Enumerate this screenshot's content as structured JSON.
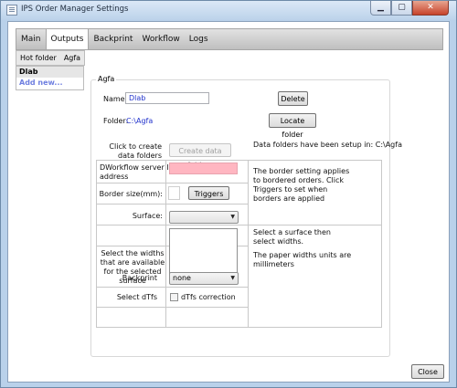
{
  "window": {
    "title": "IPS Order Manager Settings"
  },
  "caption_buttons": {
    "minimize_icon": "minimize-icon",
    "maximize_icon": "maximize-icon",
    "close_icon": "close-icon",
    "min_glyph": "▁",
    "max_glyph": "▢",
    "close_glyph": "✕"
  },
  "main_tabs": [
    "Main",
    "Outputs",
    "Backprint",
    "Workflow",
    "Logs"
  ],
  "sub_tabs": [
    "Hot folder",
    "Agfa"
  ],
  "list": {
    "items": [
      "Dlab"
    ],
    "add_label": "Add new..."
  },
  "group": {
    "title": "Agfa"
  },
  "form": {
    "name_label": "Name:",
    "name_value": "Dlab",
    "delete_label": "Delete",
    "folder_label": "Folder:",
    "folder_value": "C:\\Agfa",
    "locate_label": "Locate folder",
    "create_label_1": "Click to create",
    "create_label_2": "data folders",
    "create_button": "Create data folders",
    "create_status": "Data folders have been setup in: C:\\Agfa",
    "ip_label_1": "DWorkflow server IP",
    "ip_label_2": "address",
    "ip_value": "",
    "border_label": "Border size(mm):",
    "triggers_label": "Triggers",
    "border_help": [
      "The border setting applies",
      "to bordered orders. Click",
      "Triggers to set when",
      "borders are applied"
    ],
    "surface_label": "Surface:",
    "surface_value": "",
    "surface_help": [
      "Select a surface then",
      "select widths."
    ],
    "widths_label": [
      "Select the widths",
      "that are available",
      "for the selected",
      "surface"
    ],
    "widths_help": [
      "The paper widths units are",
      "millimeters"
    ],
    "backprint_label": "Backprint",
    "backprint_value": "none",
    "dtfs_label": "Select dTfs",
    "dtfs_checkbox_label": "dTfs correction",
    "dtfs_checked": false
  },
  "footer": {
    "close_label": "Close"
  },
  "colors": {
    "error_field": "#ffb6c1",
    "link_blue": "#2233cc",
    "add_new": "#6f7fe0"
  }
}
